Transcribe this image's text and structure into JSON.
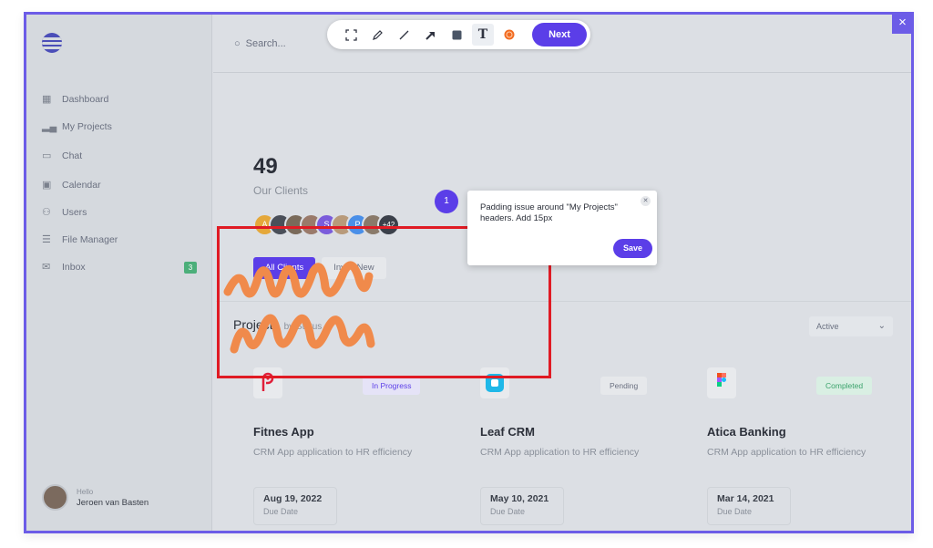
{
  "toolbar": {
    "icons": [
      "select-region-icon",
      "pen-icon",
      "line-icon",
      "arrow-icon",
      "rectangle-icon",
      "text-icon",
      "color-picker-icon"
    ],
    "next_label": "Next",
    "accent": "#5b3ee8"
  },
  "search": {
    "placeholder": "Search..."
  },
  "sidebar": {
    "items": [
      {
        "label": "Dashboard",
        "icon": "grid-icon"
      },
      {
        "label": "My Projects",
        "icon": "bar-chart-icon"
      },
      {
        "label": "Chat",
        "icon": "chat-bubble-icon"
      },
      {
        "label": "Calendar",
        "icon": "calendar-icon"
      },
      {
        "label": "Users",
        "icon": "users-icon"
      },
      {
        "label": "File Manager",
        "icon": "file-list-icon"
      },
      {
        "label": "Inbox",
        "icon": "mail-icon",
        "badge": "3"
      }
    ],
    "user": {
      "greeting": "Hello",
      "name": "Jeroen van Basten"
    }
  },
  "stats": {
    "clients_count": "49",
    "clients_label": "Our Clients",
    "avatars": [
      "A",
      "",
      "",
      "",
      "S",
      "",
      "P",
      "",
      "+42"
    ]
  },
  "tabs": [
    "All Clients",
    "Invite New"
  ],
  "projects": {
    "title": "Projects",
    "subtitle": "by Status",
    "filter_value": "Active",
    "cards": [
      {
        "name": "Fitnes App",
        "description": "CRM App application to HR efficiency",
        "status": "In Progress",
        "date": "Aug 19, 2022",
        "date_label": "Due Date"
      },
      {
        "name": "Leaf CRM",
        "description": "CRM App application to HR efficiency",
        "status": "Pending",
        "date": "May 10, 2021",
        "date_label": "Due Date"
      },
      {
        "name": "Atica Banking",
        "description": "CRM App application to HR efficiency",
        "status": "Completed",
        "date": "Mar 14, 2021",
        "date_label": "Due Date"
      }
    ]
  },
  "annotation": {
    "marker": "1",
    "comment": "Padding issue around \"My Projects\" headers. Add 15px",
    "save_label": "Save",
    "highlight_color": "#e01b24",
    "scribble_color": "#f08a4b"
  },
  "close_label": "×"
}
